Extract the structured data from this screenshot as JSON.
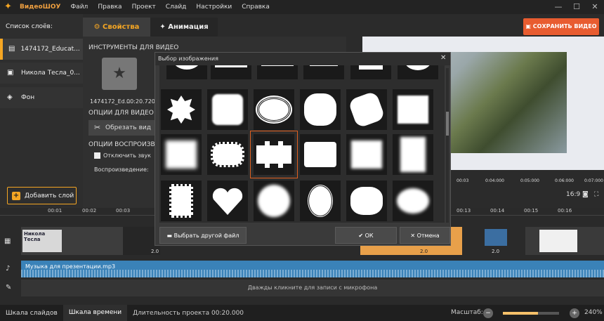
{
  "menu": {
    "app": "ВидеоШОУ",
    "items": [
      "Файл",
      "Правка",
      "Проект",
      "Слайд",
      "Настройки",
      "Справка"
    ]
  },
  "layers": {
    "title": "Список слоёв:",
    "items": [
      "1474172_Educat...",
      "Никола Тесла_0...",
      "Фон"
    ],
    "add_label": "Добавить слой"
  },
  "tabs": {
    "properties": "Свойства",
    "animation": "Анимация"
  },
  "props": {
    "tools": "ИНСТРУМЕНТЫ ДЛЯ ВИДЕО",
    "file": "1474172_Ed...",
    "duration": "00:20.720",
    "opts": "ОПЦИИ ДЛЯ ВИДЕО",
    "crop": "Обрезать вид",
    "play_opts": "ОПЦИИ ВОСПРОИЗВЕД",
    "mute": "Отключить звук",
    "playback": "Воспроизведение:"
  },
  "save": "СОХРАНИТЬ ВИДЕО",
  "dialog": {
    "title": "Выбор изображения",
    "other_file": "Выбрать другой файл",
    "ok": "ОК",
    "cancel": "Отмена"
  },
  "ruler": {
    "ticks": [
      "00:03",
      "0:04:000",
      "0:05:000",
      "0:06:000",
      "0:07:000"
    ],
    "aspect": "16:9"
  },
  "timeline": {
    "ticks": [
      "00:01",
      "00:02",
      "00:03",
      "00:13",
      "00:14",
      "00:15",
      "00:16"
    ],
    "clip1_title": "Никола Тесла",
    "durations": [
      "2.0",
      "2.0",
      "2.0"
    ],
    "audio": "Музыка для презентации.mp3",
    "mic": "Дважды кликните для записи с микрофона"
  },
  "bottom": {
    "slides": "Шкала слайдов",
    "timeline": "Шкала времени",
    "duration": "Длительность проекта 00:20.000",
    "scale_label": "Масштаб:",
    "zoom": "240%",
    "zoom_level": 0.62
  },
  "colors": {
    "accent": "#f5a623",
    "save": "#e85c30",
    "audio": "#3a82b8",
    "select": "#e06020"
  }
}
